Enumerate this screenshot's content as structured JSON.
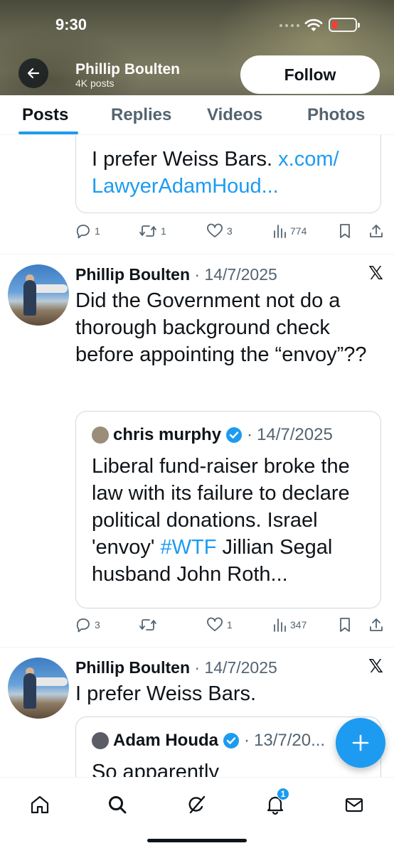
{
  "status_bar": {
    "time": "9:30"
  },
  "header": {
    "name": "Phillip Boulten",
    "posts_count": "4K posts",
    "follow_label": "Follow"
  },
  "tabs": [
    {
      "label": "Posts",
      "active": true
    },
    {
      "label": "Replies",
      "active": false
    },
    {
      "label": "Videos",
      "active": false
    },
    {
      "label": "Photos",
      "active": false
    }
  ],
  "feed": {
    "partial_post": {
      "quote_line1": "I prefer Weiss Bars. ",
      "quote_link1": "x.com/",
      "quote_link2": "LawyerAdamHoud...",
      "actions": {
        "replies": "1",
        "reposts": "1",
        "likes": "3",
        "views": "774"
      }
    },
    "post1": {
      "author": "Phillip Boulten",
      "date": "14/7/2025",
      "text": "Did the Government not do a thorough background check before appointing the “envoy”??",
      "quote": {
        "author": "chris murphy",
        "date": "14/7/2025",
        "text_before": "Liberal fund-raiser broke the law with its failure to declare political donations. Israel 'envoy' ",
        "hashtag": "#WTF",
        "text_after": " Jillian Segal husband John Roth..."
      },
      "actions": {
        "replies": "3",
        "reposts": "",
        "likes": "1",
        "views": "347"
      }
    },
    "post2": {
      "author": "Phillip Boulten",
      "date": "14/7/2025",
      "text": "I prefer Weiss Bars.",
      "quote": {
        "author": "Adam Houda",
        "date": "13/7/20...",
        "text": "So apparently"
      }
    }
  },
  "nav": {
    "notifications_count": "1"
  },
  "icons": {
    "back": "arrow-left-icon",
    "x_logo": "x-logo-icon",
    "verified": "verified-badge-icon",
    "reply": "reply-icon",
    "repost": "repost-icon",
    "like": "heart-icon",
    "views": "views-icon",
    "bookmark": "bookmark-icon",
    "share": "share-icon",
    "compose": "plus-icon",
    "home": "home-icon",
    "search": "search-icon",
    "grok": "grok-icon",
    "notifications": "bell-icon",
    "messages": "mail-icon"
  },
  "colors": {
    "accent": "#1d9bf0",
    "text": "#0f1419",
    "secondary": "#536471"
  }
}
